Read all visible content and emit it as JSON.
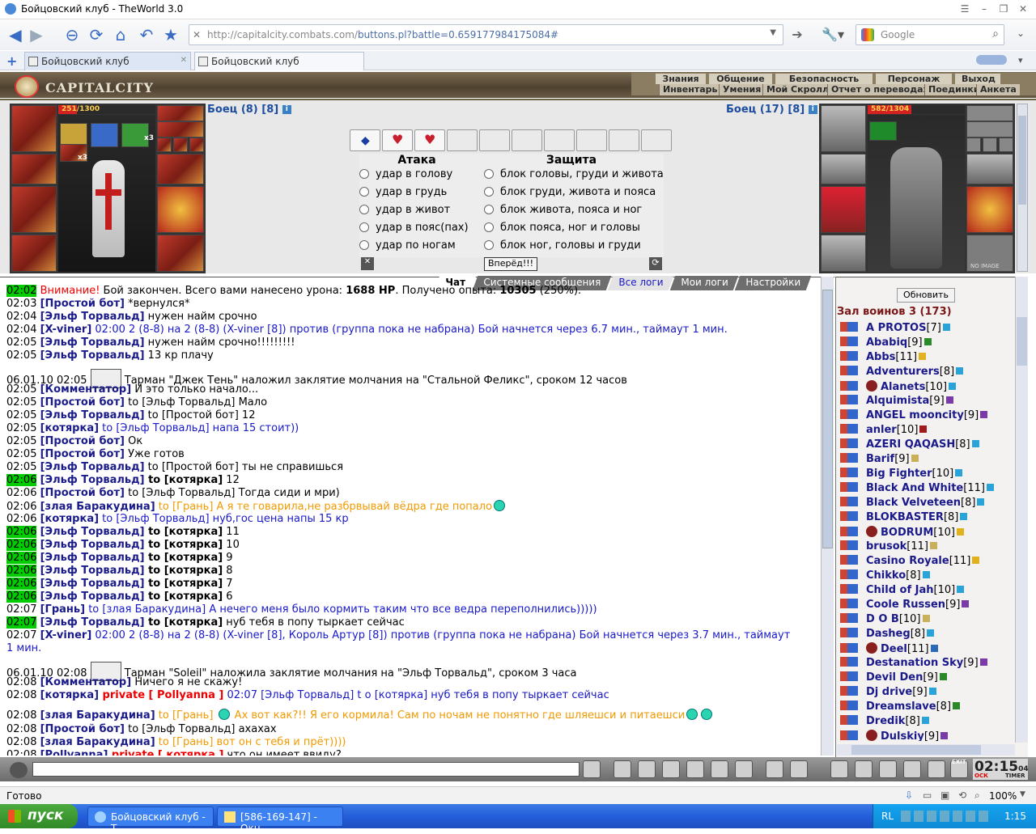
{
  "window": {
    "title": "Бойцовский клуб - TheWorld 3.0"
  },
  "browser": {
    "url_base": "http://capitalcity.combats.com/",
    "url_rest": "buttons.pl?battle=0.659177984175084#",
    "search_placeholder": "Google",
    "tabs": [
      {
        "label": "Бойцовский клуб"
      },
      {
        "label": "Бойцовский клуб"
      }
    ],
    "status": "Готово",
    "zoom": "100%"
  },
  "game": {
    "logo": "CAPITALCITY",
    "menu_top": [
      "Знания",
      "Общение",
      "Безопасность",
      "Персонаж",
      "Выход"
    ],
    "menu_bottom": [
      "Инвентарь",
      "Умения",
      "Мой Скролл",
      "Отчет о переводах",
      "Поединки",
      "Анкета"
    ],
    "left_fighter": {
      "name": "Боец (8) [8]",
      "hp_text": "251/1300",
      "hp_fraction": 0.193,
      "count_a": "x3",
      "count_b": "x3"
    },
    "right_fighter": {
      "name": "Боец (17) [8]",
      "hp_text": "582/1304",
      "hp_fraction": 0.446,
      "no_image": "NO IMAGE"
    },
    "attack_header": "Атака",
    "defense_header": "Защита",
    "attacks": [
      "удар в голову",
      "удар в грудь",
      "удар в живот",
      "удар в пояс(пах)",
      "удар по ногам"
    ],
    "defenses": [
      "блок головы, груди и живота",
      "блок груди, живота и пояса",
      "блок живота, пояса и ног",
      "блок пояса, ног и головы",
      "блок ног, головы и груди"
    ],
    "go_button": "Вперёд!!!"
  },
  "chat_tabs": [
    "Чат",
    "Системные сообщения",
    "Все логи",
    "Мои логи",
    "Настройки"
  ],
  "chat": [
    {
      "time": "02:02",
      "hl": true,
      "parts": [
        [
          "red",
          "Внимание! "
        ],
        [
          "",
          "Бой закончен. Всего вами нанесено урона: "
        ],
        [
          "b",
          "1688 HP"
        ],
        [
          "",
          ". Получено опыта: "
        ],
        [
          "b",
          "10305"
        ],
        [
          "",
          " (250%)."
        ]
      ]
    },
    {
      "time": "02:03",
      "parts": [
        [
          "nick",
          "[Простой бот]"
        ],
        [
          "",
          " *вернулся*"
        ]
      ]
    },
    {
      "time": "02:04",
      "parts": [
        [
          "nick",
          "[Эльф Торвальд]"
        ],
        [
          "",
          " нужен найм срочно"
        ]
      ]
    },
    {
      "time": "02:04",
      "parts": [
        [
          "nick",
          "[X-viner]"
        ],
        [
          "blue",
          " 02:00 2 (8-8) на 2 (8-8) (X-viner [8]) против (группа пока не набрана) Бой начнется через 6.7 мин., таймаут 1 мин."
        ]
      ]
    },
    {
      "time": "02:05",
      "parts": [
        [
          "nick",
          "[Эльф Торвальд]"
        ],
        [
          "",
          " нужен найм срочно!!!!!!!!!"
        ]
      ]
    },
    {
      "time": "02:05",
      "parts": [
        [
          "nick",
          "[Эльф Торвальд]"
        ],
        [
          "",
          " 13 кр плачу"
        ]
      ]
    },
    {
      "time": "06.01.10 02:05",
      "tall": true,
      "parts": [
        [
          "icon",
          ""
        ],
        [
          "",
          " Тарман \"Джек Тень\" наложил заклятие молчания на \"Стальной Феликс\", сроком 12 часов"
        ]
      ]
    },
    {
      "time": "02:05",
      "parts": [
        [
          "nick",
          "[Комментатор]"
        ],
        [
          "",
          " И это только начало..."
        ]
      ]
    },
    {
      "time": "02:05",
      "parts": [
        [
          "nick",
          "[Простой бот]"
        ],
        [
          "",
          " to [Эльф Торвальд] Мало"
        ]
      ]
    },
    {
      "time": "02:05",
      "parts": [
        [
          "nick",
          "[Эльф Торвальд]"
        ],
        [
          "",
          " to [Простой бот] 12"
        ]
      ]
    },
    {
      "time": "02:05",
      "parts": [
        [
          "nick",
          "[котярка]"
        ],
        [
          "blue",
          " to [Эльф Торвальд] напа 15 стоит))"
        ]
      ]
    },
    {
      "time": "02:05",
      "parts": [
        [
          "nick",
          "[Простой бот]"
        ],
        [
          "",
          " Ок"
        ]
      ]
    },
    {
      "time": "02:05",
      "parts": [
        [
          "nick",
          "[Простой бот]"
        ],
        [
          "",
          " Уже готов"
        ]
      ]
    },
    {
      "time": "02:05",
      "parts": [
        [
          "nick",
          "[Эльф Торвальд]"
        ],
        [
          "",
          " to [Простой бот] ты не справишься"
        ]
      ]
    },
    {
      "time": "02:06",
      "hl": true,
      "parts": [
        [
          "nick",
          "[Эльф Торвальд]"
        ],
        [
          "b",
          " to [котярка]"
        ],
        [
          "",
          " 12"
        ]
      ]
    },
    {
      "time": "02:06",
      "parts": [
        [
          "nick",
          "[Простой бот]"
        ],
        [
          "",
          " to [Эльф Торвальд] Тогда сиди и мри)"
        ]
      ]
    },
    {
      "time": "02:06",
      "parts": [
        [
          "nick",
          "[злая Баракудина]"
        ],
        [
          "orange",
          " to [Грань] А я те говарила,не разбрвывай вёдра где попало"
        ],
        [
          "smile",
          ""
        ]
      ]
    },
    {
      "time": "02:06",
      "parts": [
        [
          "nick",
          "[котярка]"
        ],
        [
          "blue",
          " to [Эльф Торвальд] нуб,гос цена напы 15 кр"
        ]
      ]
    },
    {
      "time": "02:06",
      "hl": true,
      "parts": [
        [
          "nick",
          "[Эльф Торвальд]"
        ],
        [
          "b",
          " to [котярка]"
        ],
        [
          "",
          " 11"
        ]
      ]
    },
    {
      "time": "02:06",
      "hl": true,
      "parts": [
        [
          "nick",
          "[Эльф Торвальд]"
        ],
        [
          "b",
          " to [котярка]"
        ],
        [
          "",
          " 10"
        ]
      ]
    },
    {
      "time": "02:06",
      "hl": true,
      "parts": [
        [
          "nick",
          "[Эльф Торвальд]"
        ],
        [
          "b",
          " to [котярка]"
        ],
        [
          "",
          " 9"
        ]
      ]
    },
    {
      "time": "02:06",
      "hl": true,
      "parts": [
        [
          "nick",
          "[Эльф Торвальд]"
        ],
        [
          "b",
          " to [котярка]"
        ],
        [
          "",
          " 8"
        ]
      ]
    },
    {
      "time": "02:06",
      "hl": true,
      "parts": [
        [
          "nick",
          "[Эльф Торвальд]"
        ],
        [
          "b",
          " to [котярка]"
        ],
        [
          "",
          " 7"
        ]
      ]
    },
    {
      "time": "02:06",
      "hl": true,
      "parts": [
        [
          "nick",
          "[Эльф Торвальд]"
        ],
        [
          "b",
          " to [котярка]"
        ],
        [
          "",
          " 6"
        ]
      ]
    },
    {
      "time": "02:07",
      "parts": [
        [
          "nick",
          "[Грань]"
        ],
        [
          "blue",
          " to [злая Баракудина] А нечего меня было кормить таким что все ведра переполнились)))))"
        ]
      ]
    },
    {
      "time": "02:07",
      "hl": true,
      "parts": [
        [
          "nick",
          "[Эльф Торвальд]"
        ],
        [
          "b",
          " to [котярка]"
        ],
        [
          "",
          " нуб тебя в попу тыркает сейчас"
        ]
      ]
    },
    {
      "time": "02:07",
      "parts": [
        [
          "nick",
          "[X-viner]"
        ],
        [
          "blue",
          " 02:00 2 (8-8) на 2 (8-8) (X-viner [8], Король Артур [8]) против (группа пока не набрана) Бой начнется через 3.7 мин., таймаут"
        ]
      ]
    },
    {
      "time": "",
      "parts": [
        [
          "blue",
          "1 мин."
        ]
      ]
    },
    {
      "time": "06.01.10 02:08",
      "tall": true,
      "parts": [
        [
          "icon",
          ""
        ],
        [
          "",
          " Тарман \"Soleil\" наложила заклятие молчания на \"Эльф Торвальд\", сроком 3 часа"
        ]
      ]
    },
    {
      "time": "02:08",
      "parts": [
        [
          "nick",
          "[Комментатор]"
        ],
        [
          "",
          " Ничего я не скажу!"
        ]
      ]
    },
    {
      "time": "02:08",
      "parts": [
        [
          "nick",
          "[котярка]"
        ],
        [
          "redb",
          " private [ Pollyanna ]"
        ],
        [
          "blue",
          " 02:07 [Эльф Торвальд] t о [котярка] нуб тебя в попу тыркает сейчас"
        ]
      ]
    },
    {
      "time": "02:08",
      "tall": true,
      "parts": [
        [
          "nick",
          "[злая Баракудина]"
        ],
        [
          "orange",
          " to [Грань] "
        ],
        [
          "smile",
          ""
        ],
        [
          "orange",
          "      Ах вот как?!! Я его кормила! Сам по ночам не понятно где шляешси и питаешси"
        ],
        [
          "smile",
          ""
        ],
        [
          "smile",
          ""
        ]
      ]
    },
    {
      "time": "02:08",
      "parts": [
        [
          "nick",
          "[Простой бот]"
        ],
        [
          "",
          " to [Эльф Торвальд] ахахах"
        ]
      ]
    },
    {
      "time": "02:08",
      "parts": [
        [
          "nick",
          "[злая Баракудина]"
        ],
        [
          "orange",
          " to [Грань] вот он с тебя и прёт))))"
        ]
      ]
    },
    {
      "time": "02:08",
      "parts": [
        [
          "nick",
          "[Pollyanna]"
        ],
        [
          "redb",
          " private [ котярка ]"
        ],
        [
          "",
          " что он имеет ввиду?"
        ]
      ]
    }
  ],
  "sidebar": {
    "refresh": "Обновить",
    "room": "Зал воинов 3 (173)",
    "users": [
      {
        "name": "A PROTOS",
        "lvl": "[7]",
        "badge": "#2aa3d8"
      },
      {
        "name": "Ababiq",
        "lvl": "[9]",
        "badge": "#2a8a2a"
      },
      {
        "name": "Abbs",
        "lvl": "[11]",
        "badge": "#e0b21e"
      },
      {
        "name": "Adventurers",
        "lvl": "[8]",
        "badge": "#2aa3d8"
      },
      {
        "name": "Alanets",
        "lvl": "[10]",
        "badge": "#2aa3d8",
        "extra": true
      },
      {
        "name": "Alquimista",
        "lvl": "[9]",
        "badge": "#7a3aa8"
      },
      {
        "name": "ANGEL mooncity",
        "lvl": "[9]",
        "badge": "#7a3aa8"
      },
      {
        "name": "anler",
        "lvl": "[10]",
        "badge": "#a01c1c"
      },
      {
        "name": "AZERI QAQASH",
        "lvl": "[8]",
        "badge": "#2aa3d8"
      },
      {
        "name": "Barif",
        "lvl": "[9]",
        "badge": "#c9b05a"
      },
      {
        "name": "Big Fighter",
        "lvl": "[10]",
        "badge": "#2aa3d8"
      },
      {
        "name": "Black And White",
        "lvl": "[11]",
        "badge": "#2aa3d8"
      },
      {
        "name": "Black Velveteen",
        "lvl": "[8]",
        "badge": "#2aa3d8"
      },
      {
        "name": "BLOKBASTER",
        "lvl": "[8]",
        "badge": "#2aa3d8"
      },
      {
        "name": "BODRUM",
        "lvl": "[10]",
        "badge": "#e0b21e",
        "extra": true
      },
      {
        "name": "brusok",
        "lvl": "[11]",
        "badge": "#c9b05a"
      },
      {
        "name": "Casino Royale",
        "lvl": "[11]",
        "badge": "#e0b21e"
      },
      {
        "name": "Chikko",
        "lvl": "[8]",
        "badge": "#2aa3d8"
      },
      {
        "name": "Child of Jah",
        "lvl": "[10]",
        "badge": "#2aa3d8"
      },
      {
        "name": "Coole Russen",
        "lvl": "[9]",
        "badge": "#7a3aa8"
      },
      {
        "name": "D O B",
        "lvl": "[10]",
        "badge": "#c9b05a"
      },
      {
        "name": "Dasheg",
        "lvl": "[8]",
        "badge": "#2aa3d8"
      },
      {
        "name": "Deel",
        "lvl": "[11]",
        "badge": "#2a6ab8",
        "extra": true
      },
      {
        "name": "Destanation Sky",
        "lvl": "[9]",
        "badge": "#7a3aa8"
      },
      {
        "name": "Devil Den",
        "lvl": "[9]",
        "badge": "#2a8a2a"
      },
      {
        "name": "Dj drive",
        "lvl": "[9]",
        "badge": "#2aa3d8"
      },
      {
        "name": "Dreamslave",
        "lvl": "[8]",
        "badge": "#2a8a2a"
      },
      {
        "name": "Dredik",
        "lvl": "[8]",
        "badge": "#2aa3d8"
      },
      {
        "name": "Dulskiy",
        "lvl": "[9]",
        "badge": "#7a3aa8",
        "extra": true
      }
    ]
  },
  "clock": {
    "time": "02:15",
    "sub": "04",
    "label_left": "ОСК",
    "label_right": "TIMER",
    "exit": "EXIT"
  },
  "taskbar": {
    "start": "пуск",
    "items": [
      "Бойцовский клуб - T...",
      "[586-169-147] - Окн..."
    ],
    "lang": "RL",
    "time": "1:15"
  }
}
